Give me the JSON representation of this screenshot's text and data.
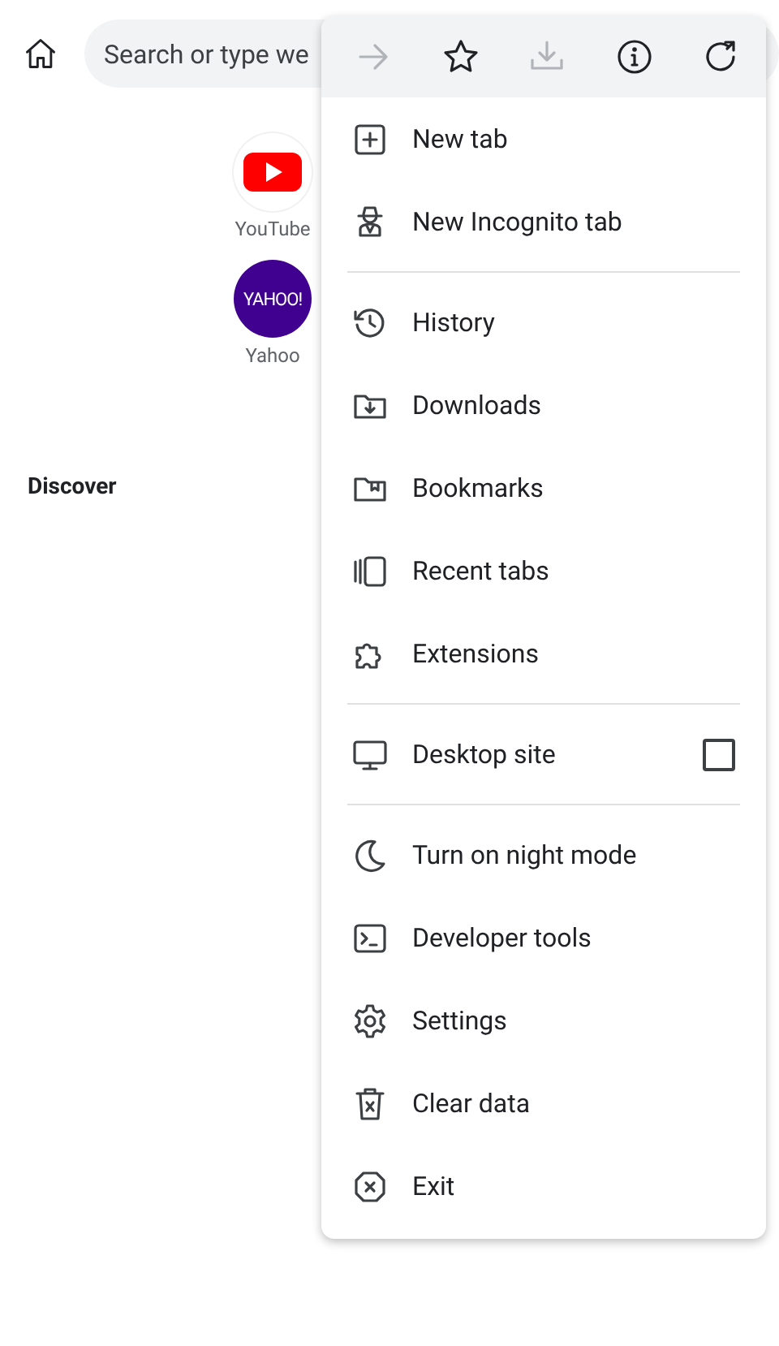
{
  "address_bar": {
    "placeholder": "Search or type we"
  },
  "shortcuts": [
    {
      "label": "YouTube",
      "kind": "youtube"
    },
    {
      "label": "Yahoo",
      "kind": "yahoo",
      "logo_text": "YAHOO!"
    }
  ],
  "discover": {
    "title": "Discover"
  },
  "menu": {
    "toolbar": [
      {
        "disabled": true
      },
      {
        "disabled": false
      },
      {
        "disabled": true
      },
      {
        "disabled": false
      },
      {
        "disabled": false
      }
    ],
    "sections": [
      [
        {
          "label": "New tab"
        },
        {
          "label": "New Incognito tab"
        }
      ],
      [
        {
          "label": "History"
        },
        {
          "label": "Downloads"
        },
        {
          "label": "Bookmarks"
        },
        {
          "label": "Recent tabs"
        },
        {
          "label": "Extensions"
        }
      ],
      [
        {
          "label": "Desktop site",
          "kind": "checkbox",
          "checked": false
        }
      ],
      [
        {
          "label": "Turn on night mode"
        },
        {
          "label": "Developer tools"
        },
        {
          "label": "Settings"
        },
        {
          "label": "Clear data"
        },
        {
          "label": "Exit"
        }
      ]
    ]
  }
}
